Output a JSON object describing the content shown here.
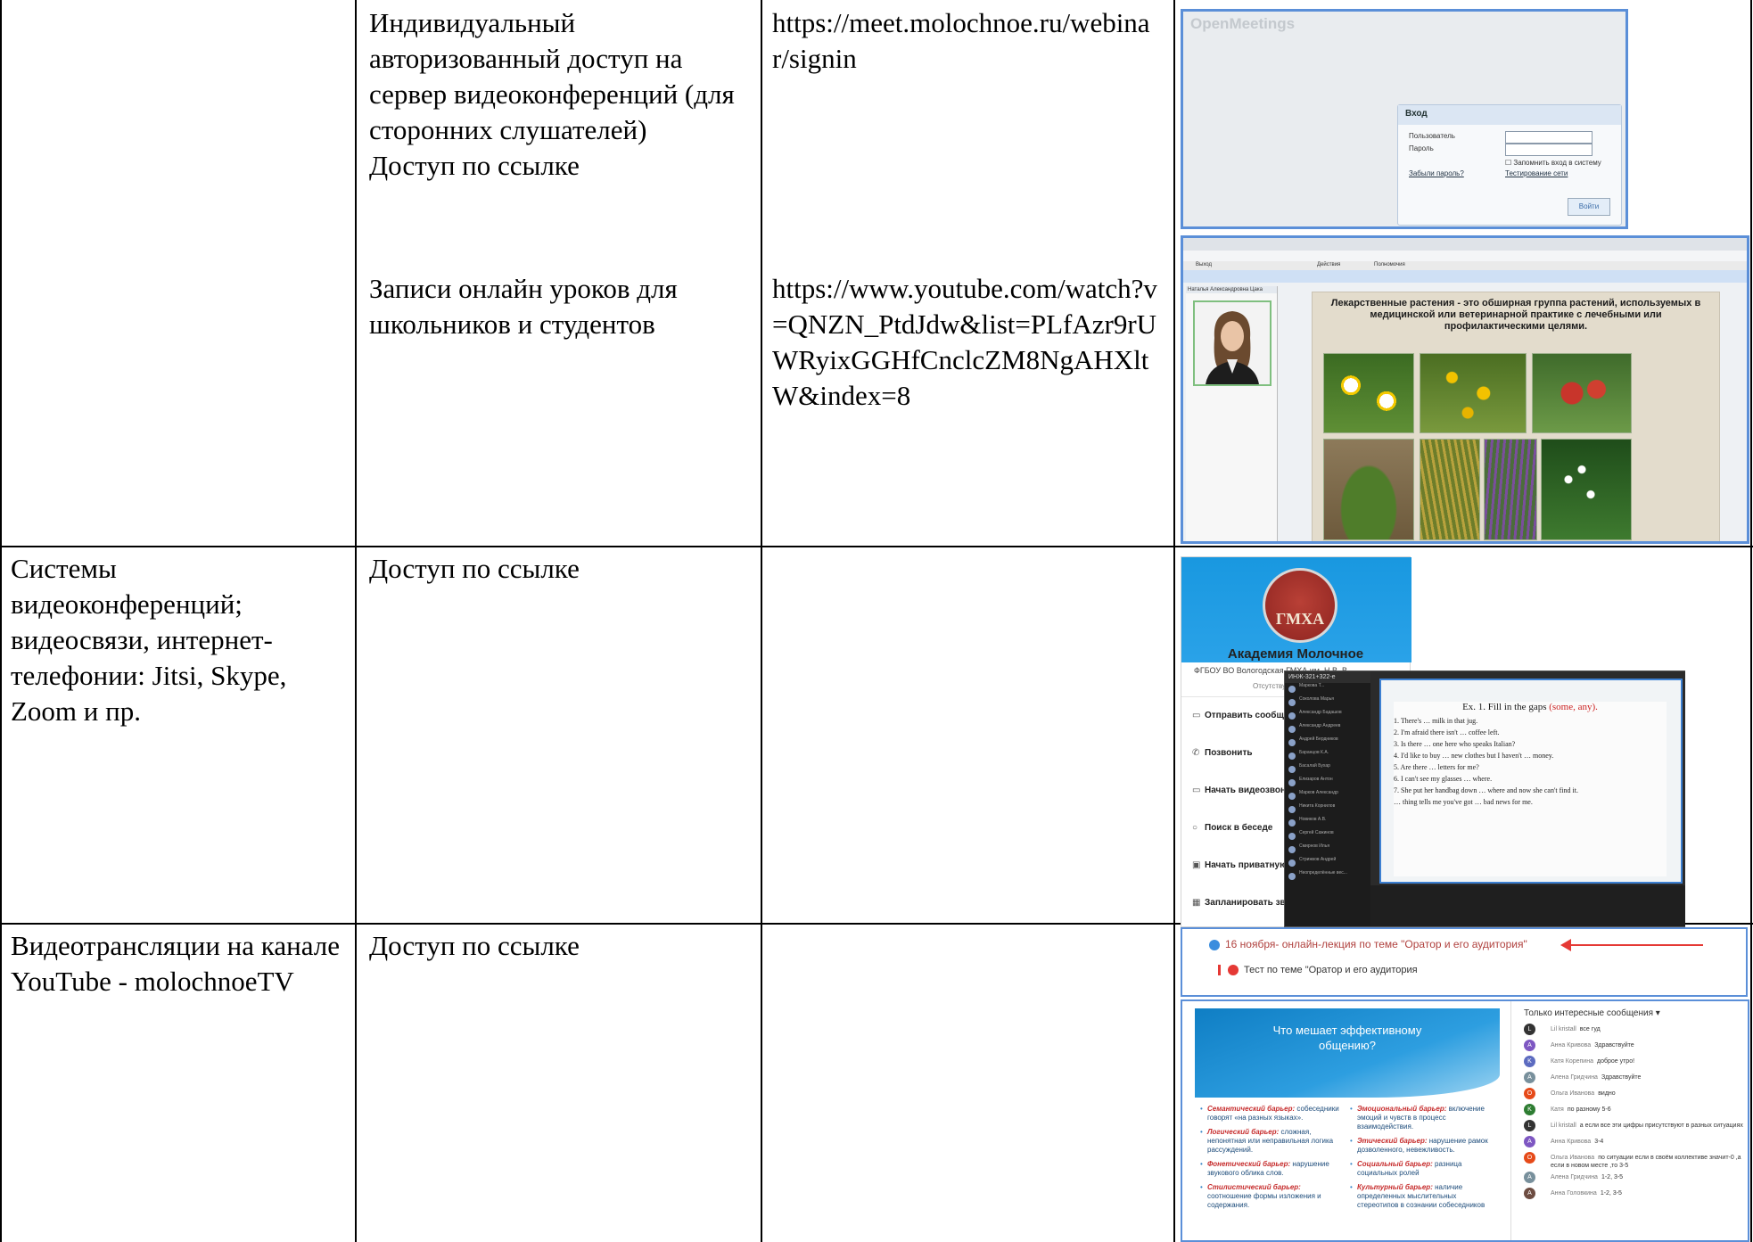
{
  "table": {
    "rows": [
      {
        "col1": "",
        "col2": "Индивидуальный авторизованный доступ на сервер видеоконференций (для сторонних слушателей)\nДоступ по ссылке",
        "col3": "https://meet.molochnoe.ru/webinar/signin"
      },
      {
        "col1": "",
        "col2": "Записи онлайн уроков для школьников и студентов",
        "col3": "https://www.youtube.com/watch?v=QNZN_PtdJdw&list=PLfAzr9rUWRyixGGHfCnclcZM8NgAHXltW&index=8"
      },
      {
        "col1": "Системы видеоконференций; видеосвязи, интернет-телефонии: Jitsi, Skype, Zoom и пр.",
        "col2": "Доступ по ссылке",
        "col3": ""
      },
      {
        "col1": "Видеотрансляции на канале YouTube - molochnoeTV",
        "col2": "Доступ по ссылке",
        "col3": ""
      }
    ]
  },
  "om_login": {
    "logo": "OpenMeetings",
    "title": "Вход",
    "user_label": "Пользователь",
    "pass_label": "Пароль",
    "remember": "Запомнить вход в систему",
    "forgot": "Забыли пароль?",
    "net_test": "Тестирование сети",
    "login_btn": "Войти"
  },
  "om_room": {
    "menu_exit": "Выход",
    "menu_actions": "Действия",
    "menu_perms": "Полномочия",
    "user_name": "Наталья Александровна Цака",
    "slide_title": "Лекарственные растения - это обширная группа растений, используемых в медицинской или ветеринарной практике с лечебными или профилактическими целями."
  },
  "skype": {
    "emblem_text": "ГМХА",
    "name": "Академия Молочное",
    "sub": "ФГБОУ ВО Вологодская ГМХА им. Н.В. В...",
    "status": "Отсутствует",
    "actions": [
      "Отправить сообще",
      "Позвонить",
      "Начать видеозвон",
      "Поиск в беседе",
      "Начать приватную",
      "Запланировать зво"
    ],
    "zoom_header": "ИНЖ-321+322-е",
    "participants": [
      "Маркова Т...",
      "Соколова Марья",
      "Александр Бадашов",
      "Александр Андреев",
      "Андрей Бердников",
      "Баранцов К.А.",
      "Басалай Бухар",
      "Елизаров Антон",
      "Марков Александр",
      "Никита Корнилов",
      "Новиков А.В.",
      "Сергей Сажинов",
      "Смирнов Илья",
      "Стрижков Андрей",
      "Неопределённые вес..."
    ],
    "exercise_title": "Ex. 1. Fill in the gaps",
    "exercise_hint": "(some, any).",
    "exercise_lines": [
      "1. There's … milk in that jug.",
      "2. I'm afraid there isn't … coffee left.",
      "3. Is there … one here who speaks Italian?",
      "4. I'd like to buy … new clothes but I haven't … money.",
      "5. Are there … letters for me?",
      "6. I can't see my glasses … where.",
      "7. She put her handbag down … where and now she can't find it.",
      "… thing tells me you've got … bad news for me."
    ]
  },
  "yt_announce": {
    "line1": "16 ноября- онлайн-лекция по теме \"Оратор и его аудитория\"",
    "line2": "Тест по теме \"Оратор и его аудитория"
  },
  "yt_live": {
    "slide_title": "Что мешает эффективному общению?",
    "left_items": [
      {
        "term": "Семантический барьер:",
        "text": "собеседники говорят «на разных языках»."
      },
      {
        "term": "Логический барьер:",
        "text": "сложная, непонятная или неправильная логика рассуждений."
      },
      {
        "term": "Фонетический барьер:",
        "text": "нарушение звукового облика слов."
      },
      {
        "term": "Стилистический барьер:",
        "text": "соотношение формы изложения и содержания."
      }
    ],
    "right_items": [
      {
        "term": "Эмоциональный барьер:",
        "text": "включение эмоций и чувств в процесс взаимодействия."
      },
      {
        "term": "Этический барьер:",
        "text": "нарушение рамок дозволенного, невежливость."
      },
      {
        "term": "Социальный барьер:",
        "text": "разница социальных ролей"
      },
      {
        "term": "Культурный барьер:",
        "text": "наличие определенных мыслительных стереотипов в сознании собеседников"
      }
    ],
    "chat_header": "Только интересные сообщения",
    "messages": [
      {
        "initial": "L",
        "color": "#333333",
        "name": "Lil kristall",
        "text": "все гуд"
      },
      {
        "initial": "A",
        "color": "#7e57c2",
        "name": "Анна Кривова",
        "text": "Здравствуйте"
      },
      {
        "initial": "K",
        "color": "#5c6bc0",
        "name": "Катя Корепина",
        "text": "доброе утро!"
      },
      {
        "initial": "A",
        "color": "#78909c",
        "name": "Алена Гридчина",
        "text": "Здравствуйте"
      },
      {
        "initial": "O",
        "color": "#e64a19",
        "name": "Ольга Иванова",
        "text": "видно"
      },
      {
        "initial": "K",
        "color": "#2e7d32",
        "name": "Катя",
        "text": "по разному 5-6"
      },
      {
        "initial": "L",
        "color": "#333333",
        "name": "Lil kristall",
        "text": "а если все эти цифры присутствуют в разных ситуациях"
      },
      {
        "initial": "A",
        "color": "#7e57c2",
        "name": "Анна Кривова",
        "text": "3-4"
      },
      {
        "initial": "O",
        "color": "#e64a19",
        "name": "Ольга Иванова",
        "text": "по ситуации если в своём коллективе значит-0 ,а если в новом месте ,то 3-5"
      },
      {
        "initial": "A",
        "color": "#78909c",
        "name": "Алена Гридчина",
        "text": "1-2, 3-5"
      },
      {
        "initial": "A",
        "color": "#6d4c41",
        "name": "Анна Головкина",
        "text": "1-2, 3-5"
      }
    ]
  }
}
